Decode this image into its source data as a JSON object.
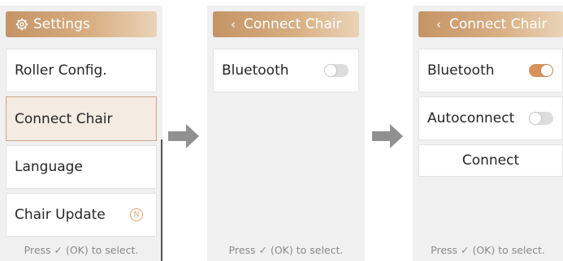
{
  "screens": [
    {
      "header": {
        "icon": "gear-icon",
        "title": "Settings"
      },
      "items": [
        "Roller Config.",
        "Connect Chair",
        "Language",
        "Chair Update"
      ],
      "badge": "N",
      "footer": "Press ✓ (OK) to select."
    },
    {
      "header": {
        "icon": "chevron-left-icon",
        "back": "‹",
        "title": "Connect Chair"
      },
      "items": [
        "Bluetooth"
      ],
      "toggles": {
        "bluetooth": false
      },
      "footer": "Press ✓ (OK) to select."
    },
    {
      "header": {
        "icon": "chevron-left-icon",
        "back": "‹",
        "title": "Connect Chair"
      },
      "items": [
        "Bluetooth",
        "Autoconnect"
      ],
      "toggles": {
        "bluetooth": true,
        "autoconnect": false
      },
      "connect_label": "Connect",
      "footer": "Press ✓ (OK) to select."
    }
  ],
  "colors": {
    "accent": "#d7925a",
    "header": "#c49466",
    "selected_bg": "#f4ebe3"
  }
}
